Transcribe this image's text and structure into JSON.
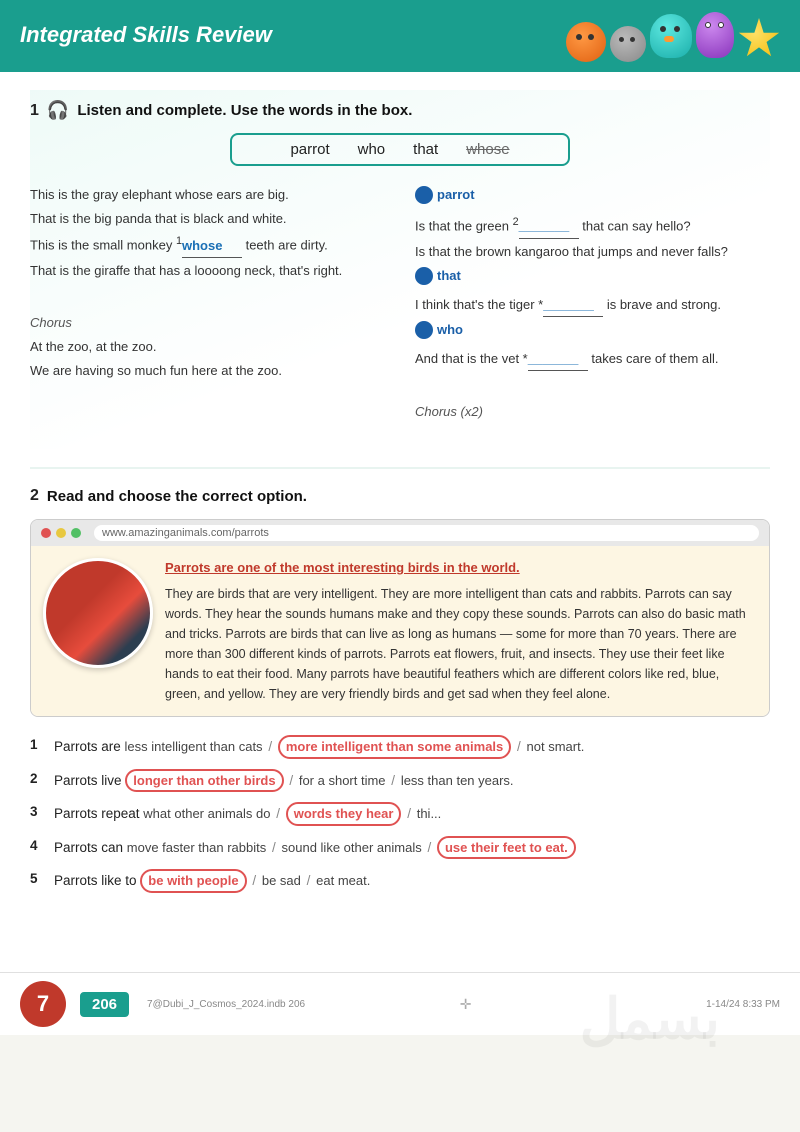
{
  "header": {
    "title": "Integrated Skills Review",
    "mascots": [
      "orange-blob",
      "gray-blob",
      "teal-bird",
      "purple-creature",
      "yellow-star"
    ]
  },
  "section1": {
    "number": "1",
    "icon": "🎧",
    "instruction": "Listen and complete. Use the words in the box.",
    "wordbox": [
      "parrot",
      "who",
      "that",
      "whose"
    ],
    "wordbox_strikethrough": [
      "whose"
    ],
    "lyrics_left": [
      "This is the gray elephant whose ears are big.",
      "That is the big panda that is black and white.",
      "This is the small monkey ¹_whose_ teeth are dirty.",
      "That is the giraffe that has a loooong neck, that's right."
    ],
    "chorus_left": [
      "Chorus",
      "At the zoo, at the zoo.",
      "We are having so much fun here at the zoo."
    ],
    "lyrics_right": [
      "Is that the green ²_______ that can say hello?",
      "Is that the brown kangaroo that jumps and never falls?",
      "I think that's the tiger *_______ is brave and strong.",
      "And that is the vet *_______ takes care of them all."
    ],
    "chorus_right": "Chorus (x2)",
    "answers": {
      "parrot": "parrot",
      "that": "that",
      "who": "who"
    },
    "blank1": "whose"
  },
  "section2": {
    "number": "2",
    "instruction": "Read and choose the correct option.",
    "browser": {
      "url": "www.amazinganimals.com/parrots",
      "title": "Parrots are one of the most interesting birds in the world.",
      "body": "They are birds that are very intelligent. They are more intelligent than cats and rabbits. Parrots can say words. They hear the sounds humans make and they copy these sounds. Parrots can also do basic math and tricks. Parrots are birds that can live as long as humans — some for more than 70 years. There are more than 300 different kinds of parrots. Parrots eat flowers, fruit, and insects. They use their feet like hands to eat their food. Many parrots have beautiful feathers which are different colors like red, blue, green, and yellow. They are very friendly birds and get sad when they feel alone."
    },
    "mcq": [
      {
        "num": "1",
        "stem": "Parrots are",
        "options": [
          "less intelligent than cats",
          "more intelligent than some animals",
          "not smart"
        ],
        "correct": 1
      },
      {
        "num": "2",
        "stem": "Parrots live",
        "options": [
          "longer than other birds",
          "for a short time",
          "less than ten years"
        ],
        "correct": 0
      },
      {
        "num": "3",
        "stem": "Parrots repeat",
        "options": [
          "what other animals do",
          "words they hear",
          "thi..."
        ],
        "correct": 1
      },
      {
        "num": "4",
        "stem": "Parrots can",
        "options": [
          "move faster than rabbits",
          "sound like other animals",
          "use their feet to eat"
        ],
        "correct": 2
      },
      {
        "num": "5",
        "stem": "Parrots like to",
        "options": [
          "be with people",
          "be sad",
          "eat meat"
        ],
        "correct": 0
      }
    ]
  },
  "footer": {
    "chapter_num": "7",
    "page_num": "206",
    "filename": "7@Dubi_J_Cosmos_2024.indb  206",
    "timestamp": "1-14/24  8:33 PM"
  }
}
